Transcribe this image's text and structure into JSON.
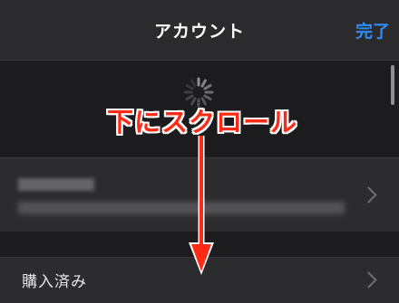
{
  "navbar": {
    "title": "アカウント",
    "done_label": "完了"
  },
  "loading": {
    "icon": "activity-spinner-icon"
  },
  "account_row": {
    "icon": "chevron-right-icon"
  },
  "purchase_row": {
    "label": "購入済み",
    "icon": "chevron-right-icon"
  },
  "annotation": {
    "text": "下にスクロール",
    "color": "#ff2a16",
    "arrow_icon": "arrow-down-icon"
  },
  "colors": {
    "accent": "#2f8cf7",
    "background": "#1c1c1e",
    "row": "#2c2c2e"
  }
}
